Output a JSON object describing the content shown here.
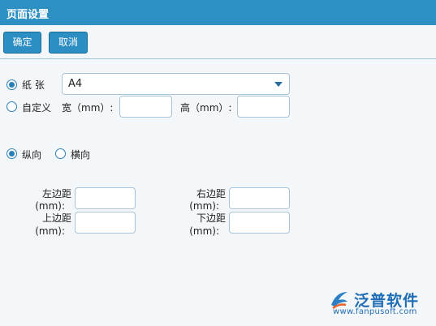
{
  "window": {
    "title": "页面设置"
  },
  "toolbar": {
    "confirm_label": "确定",
    "cancel_label": "取消"
  },
  "paper": {
    "option_label": "纸 张",
    "selected": "A4",
    "custom_label": "自定义",
    "width_label": "宽（mm）:",
    "height_label": "高（mm）:",
    "width_value": "",
    "height_value": ""
  },
  "orientation": {
    "portrait_label": "纵向",
    "landscape_label": "横向",
    "selected": "纵向"
  },
  "margins": {
    "left_label_1": "左边距",
    "left_label_2": "(mm):",
    "right_label_1": "右边距",
    "right_label_2": "(mm):",
    "top_label_1": "上边距",
    "top_label_2": "(mm):",
    "bottom_label_1": "下边距",
    "bottom_label_2": "(mm):",
    "left_value": "",
    "right_value": "",
    "top_value": "",
    "bottom_value": ""
  },
  "watermark": {
    "brand": "泛普软件",
    "url": "www.fanpusoft.com"
  }
}
